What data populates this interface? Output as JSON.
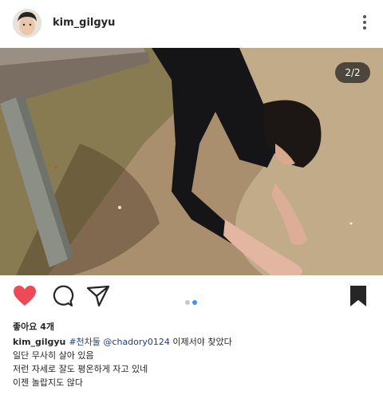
{
  "post": {
    "username": "kim_gilgyu",
    "image_counter": "2/2",
    "likes": "좋아요 4개",
    "caption": {
      "username": "kim_gilgyu",
      "hashtag": "#천차둘",
      "mention": "@chadory0124",
      "first_line_text": "이제서야 찾았다",
      "lines": [
        "일단 무사히 살아 있음",
        "저런 자세로 잘도 평온하게 자고 있네",
        "이젠 놀랍지도 않다"
      ]
    }
  },
  "icons": {
    "more": "more-vertical-icon",
    "like": "heart-icon",
    "comment": "comment-icon",
    "share": "send-icon",
    "save": "bookmark-icon"
  },
  "colors": {
    "heart": "#ed4956",
    "active_dot": "#3897f0",
    "inactive_dot": "#c7c7c7",
    "hashtag": "#1e3f7a"
  }
}
